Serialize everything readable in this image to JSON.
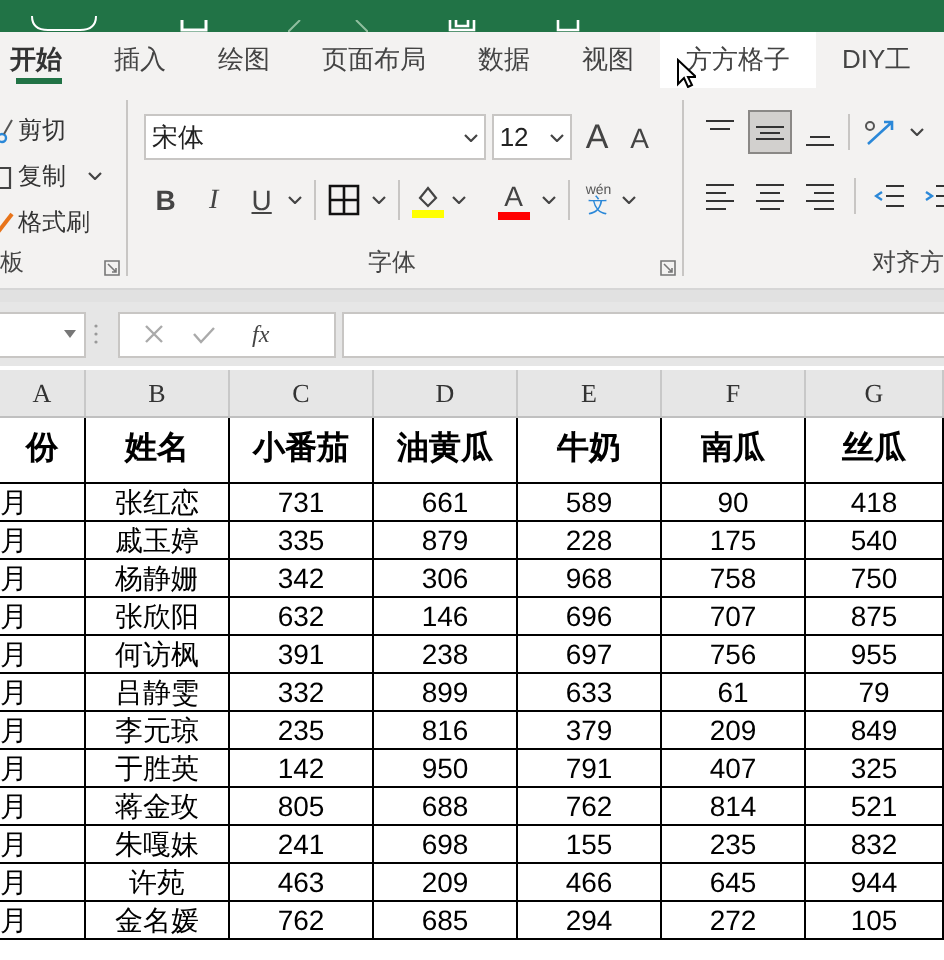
{
  "tabs": [
    {
      "label": "开始",
      "selected": true,
      "hovered": false
    },
    {
      "label": "插入",
      "selected": false,
      "hovered": false
    },
    {
      "label": "绘图",
      "selected": false,
      "hovered": false
    },
    {
      "label": "页面布局",
      "selected": false,
      "hovered": false
    },
    {
      "label": "数据",
      "selected": false,
      "hovered": false
    },
    {
      "label": "视图",
      "selected": false,
      "hovered": false
    },
    {
      "label": "方方格子",
      "selected": false,
      "hovered": true
    },
    {
      "label": "DIY工",
      "selected": false,
      "hovered": false
    }
  ],
  "clipboard": {
    "buttons": [
      "剪切",
      "复制",
      "格式刷"
    ],
    "label": "板"
  },
  "font": {
    "name": "宋体",
    "size": "12",
    "grow": "A",
    "shrink": "A",
    "bold": "B",
    "italic": "I",
    "underline": "U",
    "font_color": "A",
    "phonetic_top": "wén",
    "phonetic_bottom": "文",
    "label": "字体"
  },
  "alignment": {
    "label": "对齐方"
  },
  "formula_bar": {
    "function_label": "fx"
  },
  "sheet": {
    "column_letters": [
      "A",
      "B",
      "C",
      "D",
      "E",
      "F",
      "G"
    ],
    "header": [
      "份",
      "姓名",
      "小番茄",
      "油黄瓜",
      "牛奶",
      "南瓜",
      "丝瓜"
    ],
    "rows": [
      [
        "月",
        "张红恋",
        "731",
        "661",
        "589",
        "90",
        "418"
      ],
      [
        "月",
        "戚玉婷",
        "335",
        "879",
        "228",
        "175",
        "540"
      ],
      [
        "月",
        "杨静姗",
        "342",
        "306",
        "968",
        "758",
        "750"
      ],
      [
        "月",
        "张欣阳",
        "632",
        "146",
        "696",
        "707",
        "875"
      ],
      [
        "月",
        "何访枫",
        "391",
        "238",
        "697",
        "756",
        "955"
      ],
      [
        "月",
        "吕静雯",
        "332",
        "899",
        "633",
        "61",
        "79"
      ],
      [
        "月",
        "李元琼",
        "235",
        "816",
        "379",
        "209",
        "849"
      ],
      [
        "月",
        "于胜英",
        "142",
        "950",
        "791",
        "407",
        "325"
      ],
      [
        "月",
        "蒋金玫",
        "805",
        "688",
        "762",
        "814",
        "521"
      ],
      [
        "月",
        "朱嘎妹",
        "241",
        "698",
        "155",
        "235",
        "832"
      ],
      [
        "月",
        "许苑",
        "463",
        "209",
        "466",
        "645",
        "944"
      ],
      [
        "月",
        "金名媛",
        "762",
        "685",
        "294",
        "272",
        "105"
      ]
    ]
  }
}
